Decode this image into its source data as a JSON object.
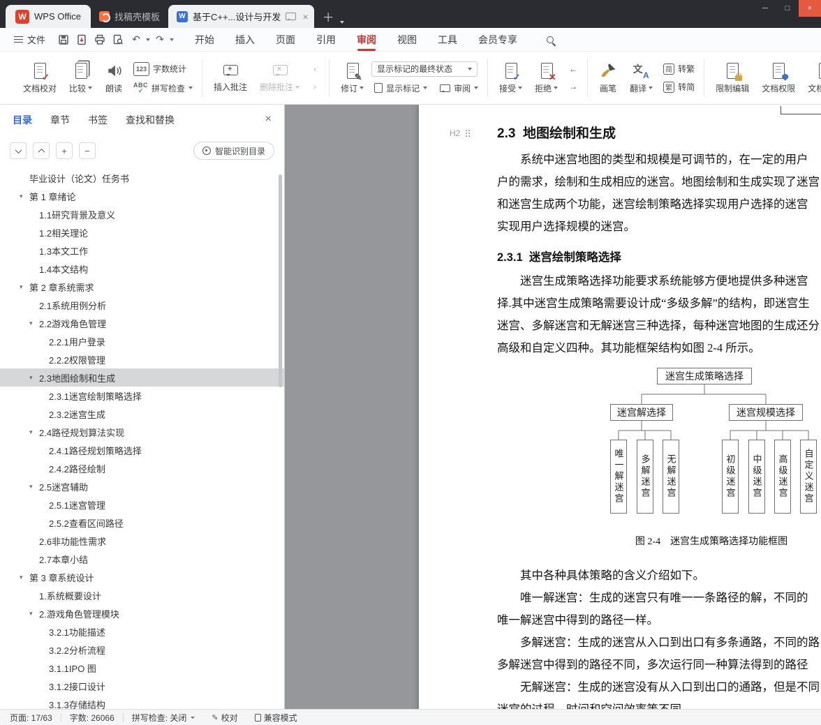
{
  "colors": {
    "accent_red": "#c5392f",
    "accent_blue": "#2d6ae0",
    "tabbar_bg": "#2a2c31",
    "doc_bg": "#95979b",
    "selected_row": "#d6d7d9",
    "close_btn": "#e5593f"
  },
  "icons": {
    "wps_w": "W",
    "writer_w": "W",
    "h2": "H2",
    "check": "✓",
    "cross": "✕",
    "pencil": "✎",
    "plus": "+",
    "minus": "−",
    "undo": "↶",
    "redo": "↷",
    "close": "×",
    "min": "─",
    "max": "□",
    "tab_close": "×",
    "add_tab": "＋",
    "tri_down": "▾",
    "nav_left": "‹",
    "nav_right": "›",
    "arrow_left": "←",
    "arrow_right": "→",
    "abc": "ABC",
    "numbers": "123",
    "translate_cn": "文",
    "translate_en": "A",
    "to_trad_src": "简",
    "to_simp_src": "繁",
    "comment_plus": "+",
    "comment_x": "×"
  },
  "window": {
    "home_tab": "WPS Office",
    "tabs": [
      {
        "label": "找稿壳模板"
      },
      {
        "label": "基于C++...设计与开发",
        "active": true
      }
    ]
  },
  "menubar": {
    "file": "文件",
    "tabs": [
      {
        "label": "开始"
      },
      {
        "label": "插入"
      },
      {
        "label": "页面"
      },
      {
        "label": "引用"
      },
      {
        "label": "审阅",
        "active": true
      },
      {
        "label": "视图"
      },
      {
        "label": "工具"
      },
      {
        "label": "会员专享"
      }
    ]
  },
  "ribbon": {
    "proofread": "文档校对",
    "compare": "比较",
    "read_aloud": "朗读",
    "word_count": "字数统计",
    "spell_check": "拼写检查",
    "insert_comment": "插入批注",
    "delete_comment": "删除批注",
    "revise": "修订",
    "markup_state": "显示标记的最终状态",
    "show_markup": "显示标记",
    "review": "审阅",
    "accept": "接受",
    "reject": "拒绝",
    "pen": "画笔",
    "translate": "翻译",
    "to_trad": "转繁",
    "to_simp": "转简",
    "restrict": "限制编辑",
    "permission": "文档权限",
    "finalize": "文档定稿"
  },
  "sidebar": {
    "tabs": [
      {
        "label": "目录",
        "active": true
      },
      {
        "label": "章节"
      },
      {
        "label": "书签"
      },
      {
        "label": "查找和替换"
      }
    ],
    "smart_toc": "智能识别目录",
    "toc": [
      {
        "label": "毕业设计（论文）任务书",
        "level": 0,
        "arrow": false
      },
      {
        "label": "第 1 章绪论",
        "level": 0
      },
      {
        "label": "1.1研究背景及意义",
        "level": 1,
        "arrow": false
      },
      {
        "label": "1.2相关理论",
        "level": 1,
        "arrow": false
      },
      {
        "label": "1.3本文工作",
        "level": 1,
        "arrow": false
      },
      {
        "label": "1.4本文结构",
        "level": 1,
        "arrow": false
      },
      {
        "label": "第 2 章系统需求",
        "level": 0
      },
      {
        "label": "2.1系统用例分析",
        "level": 1,
        "arrow": false
      },
      {
        "label": "2.2游戏角色管理",
        "level": 1
      },
      {
        "label": "2.2.1用户登录",
        "level": 2,
        "arrow": false
      },
      {
        "label": "2.2.2权限管理",
        "level": 2,
        "arrow": false
      },
      {
        "label": "2.3地图绘制和生成",
        "level": 1,
        "selected": true
      },
      {
        "label": "2.3.1迷宫绘制策略选择",
        "level": 2,
        "arrow": false
      },
      {
        "label": "2.3.2迷宫生成",
        "level": 2,
        "arrow": false
      },
      {
        "label": "2.4路径规划算法实现",
        "level": 1
      },
      {
        "label": "2.4.1路径规划策略选择",
        "level": 2,
        "arrow": false
      },
      {
        "label": "2.4.2路径绘制",
        "level": 2,
        "arrow": false
      },
      {
        "label": "2.5迷宫辅助",
        "level": 1
      },
      {
        "label": "2.5.1迷宫管理",
        "level": 2,
        "arrow": false
      },
      {
        "label": "2.5.2查看区间路径",
        "level": 2,
        "arrow": false
      },
      {
        "label": "2.6非功能性需求",
        "level": 1,
        "arrow": false
      },
      {
        "label": "2.7本章小结",
        "level": 1,
        "arrow": false
      },
      {
        "label": "第 3 章系统设计",
        "level": 0
      },
      {
        "label": "1.系统概要设计",
        "level": 1,
        "arrow": false
      },
      {
        "label": "2.游戏角色管理模块",
        "level": 1
      },
      {
        "label": "3.2.1功能描述",
        "level": 2,
        "arrow": false
      },
      {
        "label": "3.2.2分析流程",
        "level": 2,
        "arrow": false
      },
      {
        "label": "3.1.1IPO 图",
        "level": 2,
        "arrow": false
      },
      {
        "label": "3.1.2接口设计",
        "level": 2,
        "arrow": false
      },
      {
        "label": "3.1.3存储结构",
        "level": 2,
        "arrow": false
      }
    ]
  },
  "document": {
    "heading1": "2.3  地图绘制和生成",
    "para1": [
      {
        "text": "系统中迷宫地图的类型和规模是可调节的，在一定的用户",
        "ind": true
      },
      {
        "text": "户的需求，绘制和生成相应的迷宫。地图绘制和生成实现了迷宫"
      },
      {
        "text": "和迷宫生成两个功能，迷宫绘制策略选择实现用户选择的迷宫"
      },
      {
        "text": "实现用户选择规模的迷宫。"
      }
    ],
    "heading2": "2.3.1  迷宫绘制策略选择",
    "para2": [
      {
        "text": "迷宫生成策略选择功能要求系统能够方便地提供多种迷宫",
        "ind": true
      },
      {
        "text": "择.其中迷宫生成策略需要设计成“多级多解”的结构，即迷宫生"
      },
      {
        "text": "迷宫、多解迷宫和无解迷宫三种选择，每种迷宫地图的生成还分"
      },
      {
        "text": "高级和自定义四种。其功能框架结构如图 2-4 所示。"
      }
    ],
    "figure": {
      "root": "迷宫生成策略选择",
      "left": "迷宫解选择",
      "right": "迷宫规模选择",
      "left_leaves": [
        "唯一解迷宫",
        "多解迷宫",
        "无解迷宫"
      ],
      "right_leaves": [
        "初级迷宫",
        "中级迷宫",
        "高级迷宫",
        "自定义迷宫"
      ],
      "caption": "图 2-4　迷宫生成策略选择功能框图"
    },
    "para3": [
      {
        "text": "其中各种具体策略的含义介绍如下。",
        "ind": true
      },
      {
        "text": "唯一解迷宫：生成的迷宫只有唯一一条路径的解，不同的",
        "ind": true
      },
      {
        "text": "唯一解迷宫中得到的路径一样。"
      },
      {
        "text": "多解迷宫：生成的迷宫从入口到出口有多条通路，不同的路",
        "ind": true
      },
      {
        "text": "多解迷宫中得到的路径不同，多次运行同一种算法得到的路径"
      },
      {
        "text": "无解迷宫：生成的迷宫没有从入口到出口的通路，但是不同",
        "ind": true
      },
      {
        "text": "迷宫的过程、时间和空间效率等不同。"
      }
    ]
  },
  "statusbar": {
    "page": "页面: 17/63",
    "words": "字数: 26066",
    "spell": "拼写检查: 关闭",
    "proof": "校对",
    "compat": "兼容模式"
  }
}
